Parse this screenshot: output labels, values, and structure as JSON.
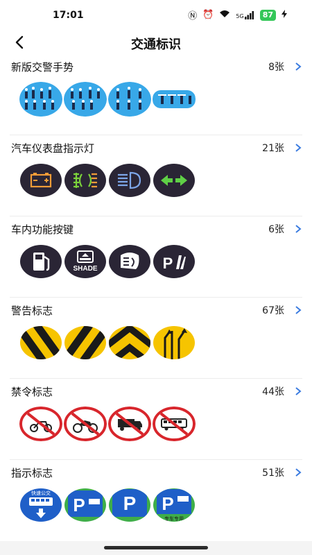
{
  "status": {
    "time": "17:01",
    "icons": [
      "nfc-icon",
      "alarm-icon",
      "wifi-icon",
      "signal-icon",
      "charging-icon"
    ],
    "network": "5G",
    "battery": "87"
  },
  "nav": {
    "title": "交通标识",
    "back_icon": "back-arrow-icon"
  },
  "sections": [
    {
      "title": "新版交警手势",
      "count": "8张"
    },
    {
      "title": "汽车仪表盘指示灯",
      "count": "21张"
    },
    {
      "title": "车内功能按键",
      "count": "6张"
    },
    {
      "title": "警告标志",
      "count": "67张"
    },
    {
      "title": "禁令标志",
      "count": "44张"
    },
    {
      "title": "指示标志",
      "count": "51张"
    }
  ],
  "thumb_text": {
    "shade": "SHADE",
    "park": "P",
    "bus_lane": "快速公交",
    "bus_only": "专车专用"
  },
  "colors": {
    "accent": "#3a7be0",
    "dashboard_bg": "#2a2535",
    "warning_yellow": "#f6c400",
    "prohibit_red": "#d8262c",
    "indicator_blue": "#1f5fc8",
    "police_sky": "#38a8e8"
  }
}
